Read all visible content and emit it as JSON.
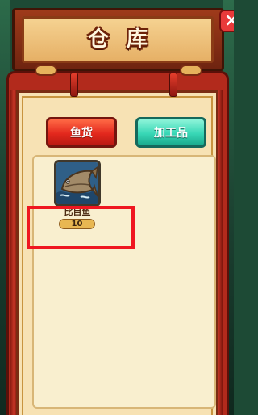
{
  "window": {
    "title": "仓库",
    "close_label": "×"
  },
  "tabs": [
    {
      "label": "鱼货",
      "selected": true
    },
    {
      "label": "加工品",
      "selected": false
    }
  ],
  "inventory": {
    "items": [
      {
        "name": "比目鱼",
        "count": "10",
        "icon": "flounder-fish-icon"
      }
    ]
  },
  "colors": {
    "fish_tab": "#e3281d",
    "processed_tab": "#38d7b6",
    "highlight": "#ef1620",
    "panel_red": "#b22a1c",
    "panel_cream": "#f7e2b4"
  }
}
